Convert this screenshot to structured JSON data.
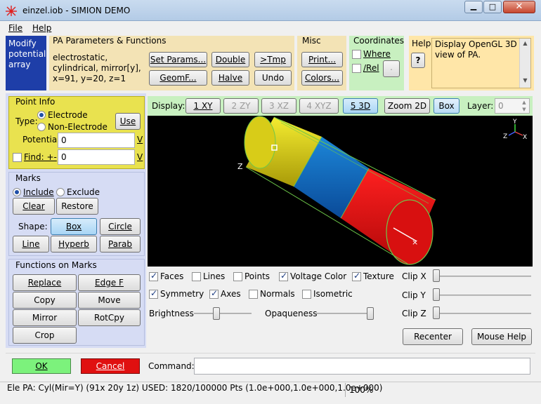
{
  "title_bar": {
    "title": "einzel.iob - SIMION DEMO",
    "app_icon": "simion-ion-icon"
  },
  "menu": {
    "file": "File",
    "help": "Help"
  },
  "mode": {
    "label": "Modify potential array"
  },
  "pa_params": {
    "header": "PA Parameters & Functions",
    "description": "electrostatic, cylindrical, mirror[y], x=91, y=20, z=1",
    "set_params": "Set Params...",
    "double": "Double",
    "tmp": ">Tmp",
    "geomf": "GeomF...",
    "halve": "Halve",
    "undo": "Undo"
  },
  "misc": {
    "header": "Misc",
    "print": "Print...",
    "colors": "Colors..."
  },
  "coordinates": {
    "header": "Coordinates",
    "where": "Where",
    "rel": "/Rel",
    "dot": "."
  },
  "help": {
    "header": "Help:",
    "question": "?",
    "text": "Display OpenGL 3D view of PA."
  },
  "point_info": {
    "header": "Point Info",
    "type_label": "Type:",
    "electrode": "Electrode",
    "non_electrode": "Non-Electrode",
    "use": "Use",
    "potential_label": "Potential:",
    "potential_value": "0",
    "potential_unit": "V",
    "find_label": "Find: +-",
    "find_value": "0",
    "find_unit": "V"
  },
  "marks": {
    "header": "Marks",
    "include": "Include",
    "exclude": "Exclude",
    "clear": "Clear",
    "restore": "Restore",
    "shape_label": "Shape:",
    "box": "Box",
    "circle": "Circle",
    "line": "Line",
    "hyperb": "Hyperb",
    "parab": "Parab"
  },
  "functions": {
    "header": "Functions on Marks",
    "replace": "Replace",
    "edge_f": "Edge F",
    "copy": "Copy",
    "move": "Move",
    "mirror": "Mirror",
    "rotcpy": "RotCpy",
    "crop": "Crop"
  },
  "display": {
    "label": "Display:",
    "xy": "1 XY",
    "zy": "2 ZY",
    "xz": "3 XZ",
    "xyz": "4 XYZ",
    "d3": "5 3D",
    "zoom2d": "Zoom 2D",
    "box": "Box",
    "layer_label": "Layer:",
    "layer_value": "0"
  },
  "view3d": {
    "axis_x": "X",
    "axis_y": "Y",
    "axis_z": "Z",
    "z_marker": "Z"
  },
  "options": {
    "faces": "Faces",
    "lines": "Lines",
    "points": "Points",
    "voltage_color": "Voltage Color",
    "texture": "Texture",
    "symmetry": "Symmetry",
    "axes": "Axes",
    "normals": "Normals",
    "isometric": "Isometric",
    "brightness": "Brightness",
    "opaqueness": "Opaqueness",
    "clip_x": "Clip X",
    "clip_y": "Clip Y",
    "clip_z": "Clip Z",
    "recenter": "Recenter",
    "mouse_help": "Mouse Help",
    "brightness_level": 0.38,
    "opaqueness_level": 1.0,
    "clip_x_level": 0,
    "clip_y_level": 0,
    "clip_z_level": 0
  },
  "bottom": {
    "ok": "OK",
    "cancel": "Cancel",
    "command_label": "Command:",
    "command_value": ""
  },
  "status": {
    "left": "Ele PA: Cyl(Mir=Y) (91x 20y 1z)  USED: 1820/100000 Pts (1.0e+000,1.0e+000,1.0e+000)",
    "zoom": "100%"
  },
  "colors": {
    "yellow_panel": "#e9e24f",
    "pa_panel": "#f3e3b5",
    "misc_panel": "#f3e3b5",
    "coord_panel": "#c8f0c0",
    "help_panel": "#ffe6a8",
    "mode_panel": "#1e3ea8",
    "left_panel": "#d6dcf4",
    "ok_green": "#7cf27c",
    "cancel_red": "#e01010"
  }
}
